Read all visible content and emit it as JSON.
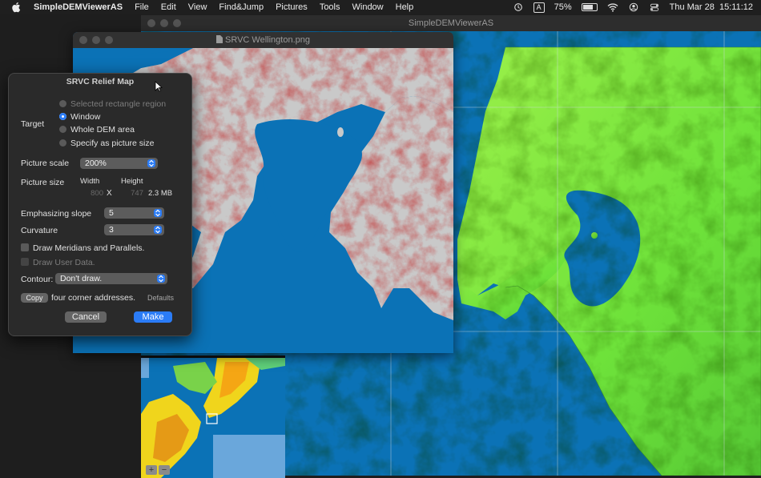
{
  "menubar": {
    "app_name": "SimpleDEMViewerAS",
    "items": [
      "File",
      "Edit",
      "View",
      "Find&Jump",
      "Pictures",
      "Tools",
      "Window",
      "Help"
    ],
    "input_badge": "A",
    "battery": "75%",
    "datetime": "Thu Mar 28  15:11:12"
  },
  "windows": {
    "main_title": "SimpleDEMViewerAS",
    "front_title": "SRVC Wellington.png"
  },
  "dialog": {
    "title": "SRVC Relief Map",
    "target_label": "Target",
    "target_options": [
      "Selected rectangle region",
      "Window",
      "Whole DEM area",
      "Specify as picture size"
    ],
    "target_selected": "Window",
    "scale_label": "Picture scale",
    "scale_value": "200%",
    "size_label": "Picture size",
    "width_label": "Width",
    "height_label": "Height",
    "width_value": "800",
    "height_value": "747",
    "size_x": "X",
    "file_size": "2.3 MB",
    "slope_label": "Emphasizing slope",
    "slope_value": "5",
    "curvature_label": "Curvature",
    "curvature_value": "3",
    "meridians_label": "Draw Meridians and Parallels.",
    "userdata_label": "Draw User Data.",
    "contour_label": "Contour:",
    "contour_value": "Don't draw.",
    "copy_label": "Copy",
    "copy_suffix": "four corner addresses.",
    "defaults_label": "Defaults",
    "cancel_label": "Cancel",
    "make_label": "Make"
  },
  "colors": {
    "sea": "#0b72b6",
    "land_green": "#7ee83a",
    "relief_red": "#b53a3a",
    "accent": "#2b7cf6"
  },
  "minimap": {
    "zoom_in": "+",
    "zoom_out": "−"
  }
}
